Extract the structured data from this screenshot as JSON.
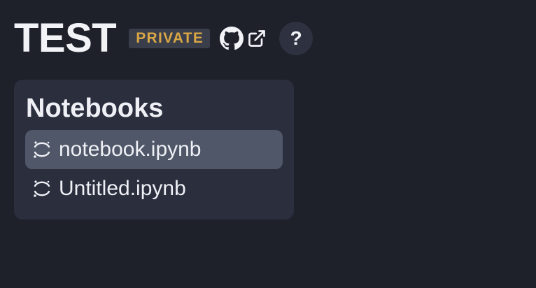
{
  "header": {
    "title": "TEST",
    "badge": "PRIVATE",
    "github_icon": "github-icon",
    "external_icon": "external-link-icon",
    "help_label": "?"
  },
  "notebooks": {
    "title": "Notebooks",
    "items": [
      {
        "label": "notebook.ipynb",
        "icon": "jupyter-icon",
        "selected": true
      },
      {
        "label": "Untitled.ipynb",
        "icon": "jupyter-icon",
        "selected": false
      }
    ]
  },
  "colors": {
    "background": "#1e202a",
    "panel": "#2a2e3d",
    "selected_row": "#505768",
    "badge_text": "#d8a645",
    "badge_bg": "#3a3d4a"
  }
}
